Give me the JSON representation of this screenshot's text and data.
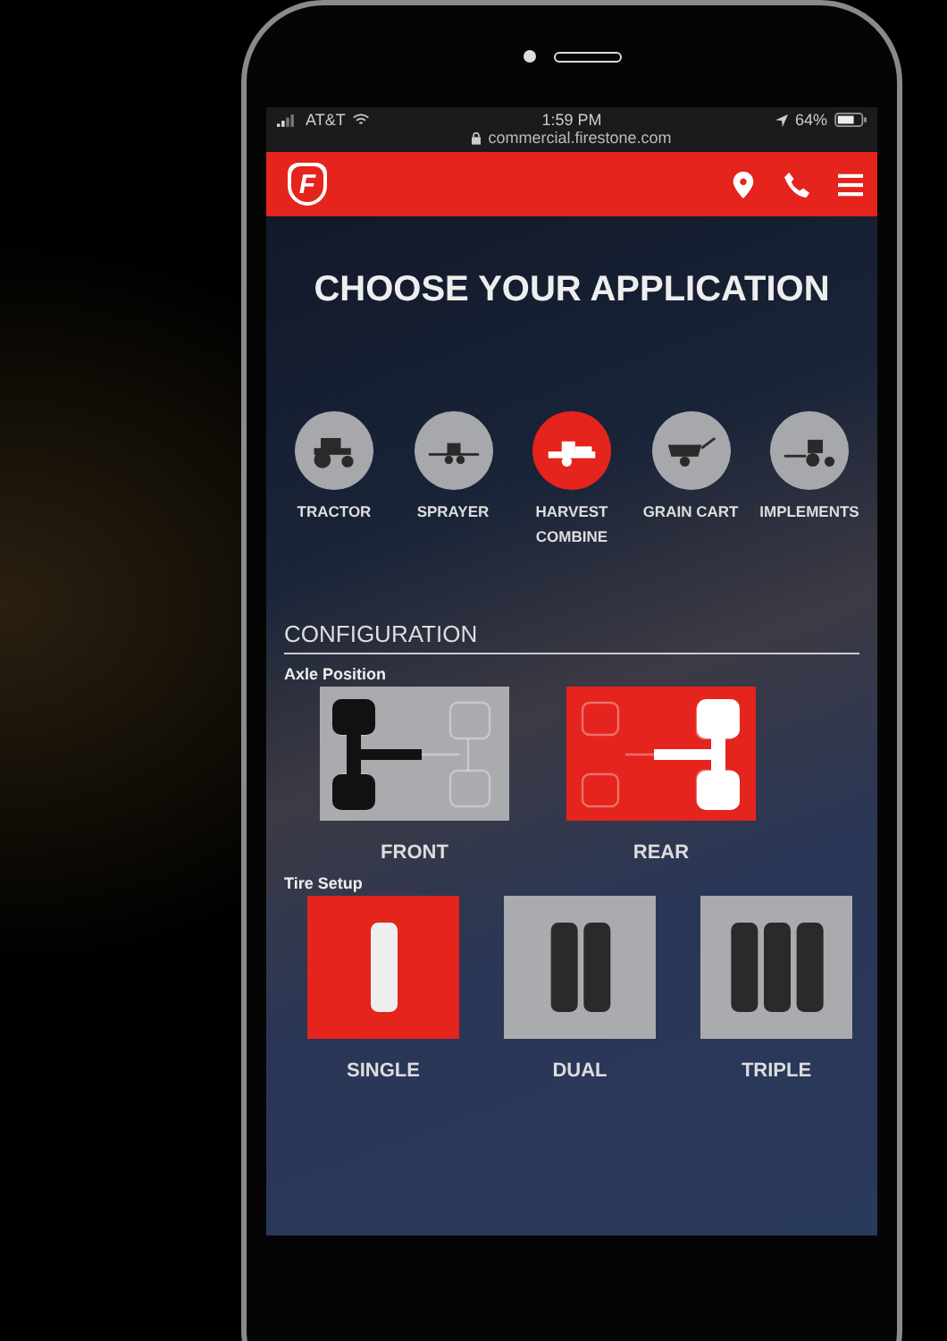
{
  "status_bar": {
    "carrier": "AT&T",
    "time": "1:59 PM",
    "battery": "64%",
    "url": "commercial.firestone.com"
  },
  "header": {
    "logo_letter": "F"
  },
  "title": "CHOOSE YOUR APPLICATION",
  "applications": [
    {
      "kind": "tractor",
      "label": "TRACTOR",
      "selected": false
    },
    {
      "kind": "sprayer",
      "label": "SPRAYER",
      "selected": false
    },
    {
      "kind": "combine",
      "label": "HARVEST COMBINE",
      "selected": true
    },
    {
      "kind": "cart",
      "label": "GRAIN CART",
      "selected": false
    },
    {
      "kind": "implement",
      "label": "IMPLEMENTS",
      "selected": false
    }
  ],
  "configuration": {
    "heading": "CONFIGURATION",
    "axle": {
      "label": "Axle Position",
      "options": [
        {
          "kind": "front",
          "label": "FRONT",
          "selected": false
        },
        {
          "kind": "rear",
          "label": "REAR",
          "selected": true
        }
      ]
    },
    "tires": {
      "label": "Tire Setup",
      "options": [
        {
          "kind": "single",
          "label": "SINGLE",
          "selected": true
        },
        {
          "kind": "dual",
          "label": "DUAL",
          "selected": false
        },
        {
          "kind": "triple",
          "label": "TRIPLE",
          "selected": false
        }
      ]
    }
  }
}
